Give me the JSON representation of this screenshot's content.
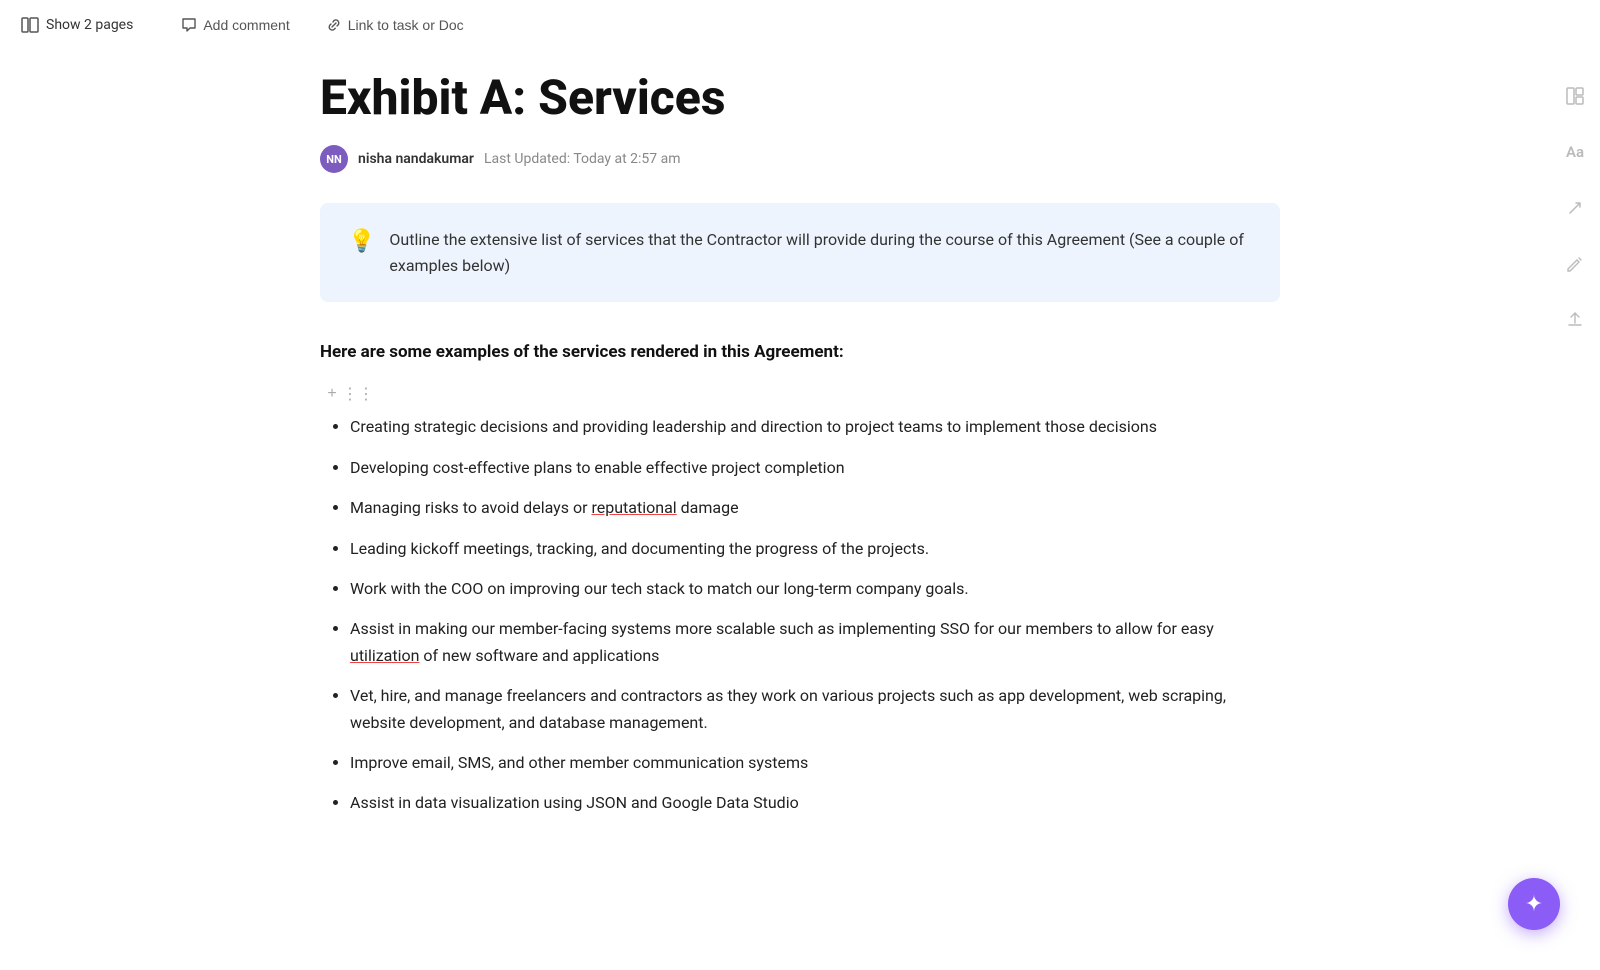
{
  "toolbar": {
    "show_pages_label": "Show 2 pages",
    "add_comment_label": "Add comment",
    "link_label": "Link to task or Doc"
  },
  "document": {
    "title": "Exhibit A: Services",
    "author_initials": "NN",
    "author_name": "nisha nandakumar",
    "last_updated_label": "Last Updated:",
    "last_updated_time": "Today at 2:57 am"
  },
  "callout": {
    "icon": "💡",
    "text": "Outline the extensive list of services that the Contractor will provide during the course of this Agreement (See a couple of examples below)"
  },
  "section": {
    "heading": "Here are some examples of the services rendered in this Agreement:",
    "items": [
      "Creating strategic decisions and providing leadership and direction to project teams to implement those decisions",
      "Developing cost-effective plans to enable effective project completion",
      "Managing risks to avoid delays or reputational damage",
      "Leading kickoff meetings, tracking, and documenting the progress of the projects.",
      "Work with the COO on improving our tech stack to match our long-term company goals.",
      "Assist in making our member-facing systems more scalable such as implementing SSO for our members to allow for easy utilization of new software and applications",
      "Vet, hire, and manage freelancers and contractors as they work on various projects such as app development, web scraping, website development, and database management.",
      "Improve email, SMS, and other member communication systems",
      "Assist in data visualization using JSON and Google Data Studio"
    ],
    "underline_words": [
      "reputational",
      "utilization"
    ]
  },
  "sidebar": {
    "icons": [
      {
        "name": "layout-icon",
        "symbol": "⊞"
      },
      {
        "name": "font-icon",
        "symbol": "Aa"
      },
      {
        "name": "share-icon",
        "symbol": "↗"
      },
      {
        "name": "edit-icon",
        "symbol": "✏"
      },
      {
        "name": "export-icon",
        "symbol": "⬆"
      }
    ]
  },
  "fab": {
    "symbol": "✦"
  }
}
